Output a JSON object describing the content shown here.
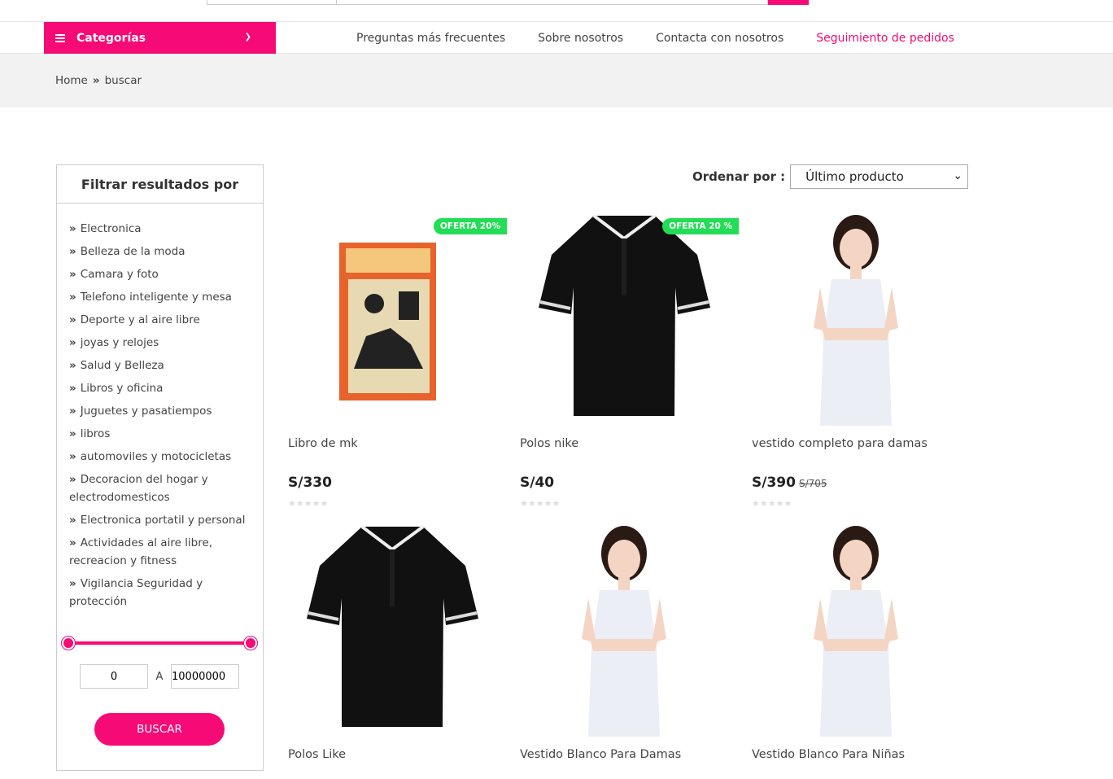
{
  "nav": {
    "categories_label": "Categorías",
    "links": [
      "Preguntas más frecuentes",
      "Sobre nosotros",
      "Contacta con nosotros",
      "Seguimiento de pedidos"
    ]
  },
  "breadcrumb": {
    "home": "Home",
    "sep": "»",
    "current": "buscar"
  },
  "sidebar": {
    "title": "Filtrar resultados por",
    "categories": [
      "Electronica",
      "Belleza de la moda",
      "Camara y foto",
      "Telefono inteligente y mesa",
      "Deporte y al aire libre",
      "joyas y relojes",
      "Salud y Belleza",
      "Libros y oficina",
      "Juguetes y pasatiempos",
      "libros",
      "automoviles y motocicletas",
      "Decoracion del hogar y electrodomesticos",
      "Electronica portatil y personal",
      "Actividades al aire libre, recreacion y fitness",
      "Vigilancia Seguridad y protección"
    ],
    "price_min": "0",
    "range_sep": "A",
    "price_max": "10000000",
    "search_button": "BUSCAR"
  },
  "sort": {
    "label": "Ordenar por :",
    "selected": "Último producto"
  },
  "products": [
    {
      "name": "Libro de mk",
      "price": "S/330",
      "old_price": "",
      "badge": "OFERTA 20%",
      "rating": 0,
      "image": "book-icon"
    },
    {
      "name": "Polos nike",
      "price": "S/40",
      "old_price": "",
      "badge": "OFERTA 20 %",
      "rating": 0,
      "image": "polo-shirt-icon"
    },
    {
      "name": "vestido completo para damas",
      "price": "S/390",
      "old_price": "S/705",
      "badge": "",
      "rating": 0,
      "image": "dress-model-icon"
    },
    {
      "name": "Polos Like",
      "price": "",
      "old_price": "",
      "badge": "",
      "rating": 0,
      "image": "polo-shirt-icon"
    },
    {
      "name": "Vestido Blanco Para Damas",
      "price": "",
      "old_price": "",
      "badge": "",
      "rating": 0,
      "image": "dress-model-icon"
    },
    {
      "name": "Vestido Blanco Para Niñas",
      "price": "",
      "old_price": "",
      "badge": "",
      "rating": 0,
      "image": "dress-model-icon"
    }
  ],
  "colors": {
    "accent": "#f50a76",
    "badge": "#22dd55"
  }
}
